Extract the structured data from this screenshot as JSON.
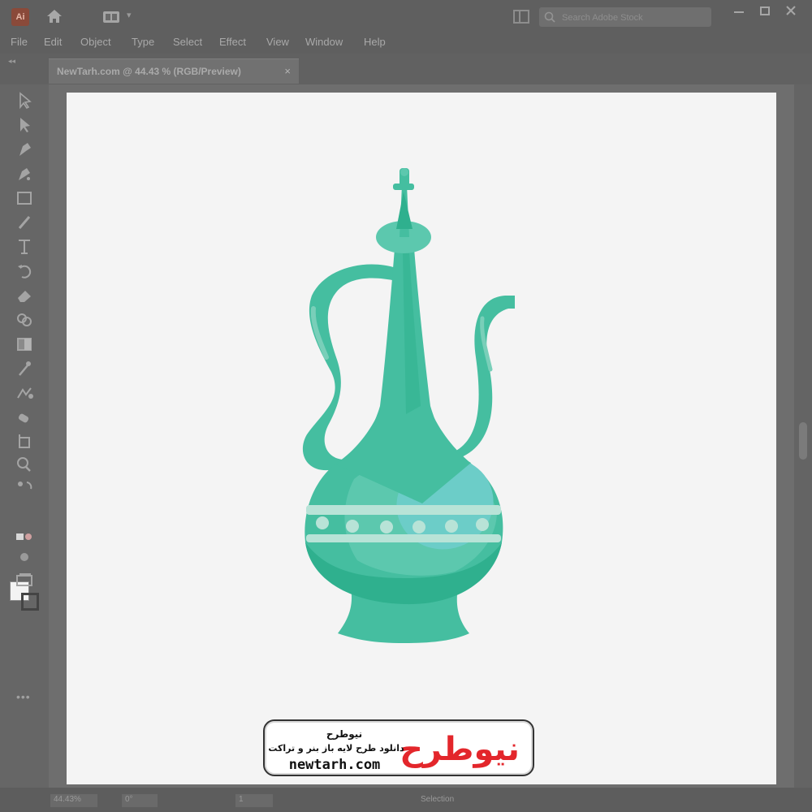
{
  "app": {
    "logo_text": "Ai"
  },
  "search": {
    "placeholder": "Search Adobe Stock"
  },
  "menu": [
    "File",
    "Edit",
    "Object",
    "Type",
    "Select",
    "Effect",
    "View",
    "Window",
    "Help"
  ],
  "document_tab": {
    "title": "NewTarh.com @ 44.43 % (RGB/Preview)",
    "close": "×"
  },
  "tools": [
    "selection-tool",
    "direct-selection-tool",
    "pen-tool",
    "curvature-tool",
    "rectangle-tool",
    "paintbrush-tool",
    "type-tool",
    "rotate-tool",
    "eraser-tool",
    "shape-builder-tool",
    "gradient-tool",
    "eyedropper-tool",
    "blend-tool",
    "symbol-sprayer-tool",
    "artboard-tool",
    "zoom-tool"
  ],
  "toolbar": {
    "more": "•••"
  },
  "status": {
    "zoom": "44.43%",
    "rotation": "0°",
    "artboard": "1",
    "mode": "Selection"
  },
  "artwork": {
    "subject": "ewer-illustration",
    "colors": {
      "body": "#45bea0",
      "dark": "#2fb08e",
      "light": "#79cfb9",
      "highlight": "#6ccdc8",
      "band_dots": "#b8e3d7"
    }
  },
  "watermark": {
    "logo_text": "نیوطرح",
    "title": "نیوطرح",
    "tagline": "دانلود طرح لایه باز بنر و تراکت",
    "url": "newtarh.com",
    "colors": {
      "accent": "#e3262b",
      "text": "#111111"
    }
  }
}
